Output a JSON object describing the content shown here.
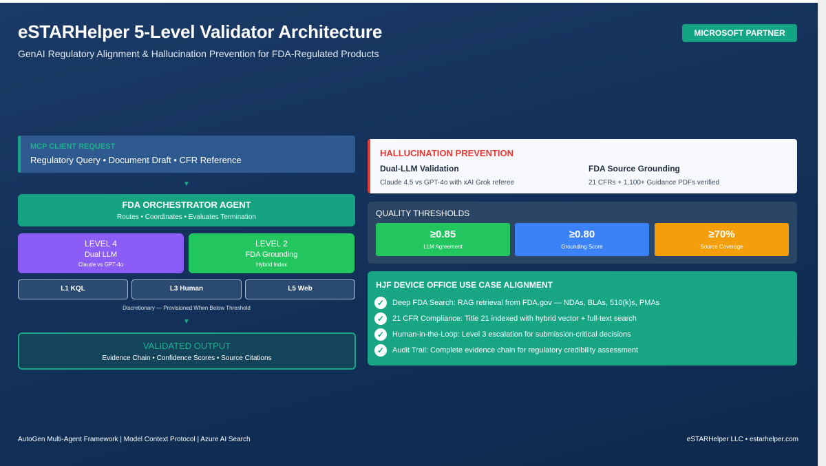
{
  "header": {
    "title": "eSTARHelper 5-Level Validator Architecture",
    "subtitle": "GenAI Regulatory Alignment & Hallucination Prevention for FDA-Regulated Products",
    "badge": "MICROSOFT PARTNER"
  },
  "flow": {
    "arrow_glyph": "▼",
    "mcp": {
      "label": "MCP CLIENT REQUEST",
      "text": "Regulatory Query • Document Draft • CFR Reference"
    },
    "orchestrator": {
      "title": "FDA ORCHESTRATOR AGENT",
      "subtitle": "Routes • Coordinates • Evaluates Termination"
    },
    "level4": {
      "title": "LEVEL 4",
      "subtitle": "Dual LLM",
      "detail": "Claude vs GPT-4o"
    },
    "level2": {
      "title": "LEVEL 2",
      "subtitle": "FDA Grounding",
      "detail": "Hybrid Index"
    },
    "discretionary_levels": [
      "L1 KQL",
      "L3 Human",
      "L5 Web"
    ],
    "discretionary_note": "Discretionary — Provisioned When Below Threshold",
    "output": {
      "title": "VALIDATED OUTPUT",
      "subtitle": "Evidence Chain • Confidence Scores • Source Citations"
    }
  },
  "hallucination": {
    "title": "HALLUCINATION PREVENTION",
    "items": [
      {
        "heading": "Dual-LLM Validation",
        "text": "Claude 4.5 vs GPT-4o with xAI Grok referee"
      },
      {
        "heading": "FDA Source Grounding",
        "text": "21 CFRs + 1,100+ Guidance PDFs verified"
      }
    ]
  },
  "quality": {
    "title": "QUALITY THRESHOLDS",
    "metrics": [
      {
        "value": "≥0.85",
        "label": "LLM Agreement",
        "color": "#22c55e"
      },
      {
        "value": "≥0.80",
        "label": "Grounding Score",
        "color": "#3b82f6"
      },
      {
        "value": "≥70%",
        "label": "Source Coverage",
        "color": "#f59e0b"
      }
    ]
  },
  "hjf": {
    "title": "HJF DEVICE OFFICE USE CASE ALIGNMENT",
    "check_glyph": "✓",
    "items": [
      "Deep FDA Search: RAG retrieval from FDA.gov — NDAs, BLAs, 510(k)s, PMAs",
      "21 CFR Compliance: Title 21 indexed with hybrid vector + full-text search",
      "Human-in-the-Loop: Level 3 escalation for submission-critical decisions",
      "Audit Trail: Complete evidence chain for regulatory credibility assessment"
    ]
  },
  "footer": {
    "left": "AutoGen Multi-Agent Framework | Model Context Protocol | Azure AI Search",
    "right": "eSTARHelper LLC • estarhelper.com"
  },
  "colors": {
    "accent_teal": "#15a381",
    "alert_red": "#e53935",
    "level4_purple": "#8b5cf6",
    "level2_green": "#22c55e"
  }
}
